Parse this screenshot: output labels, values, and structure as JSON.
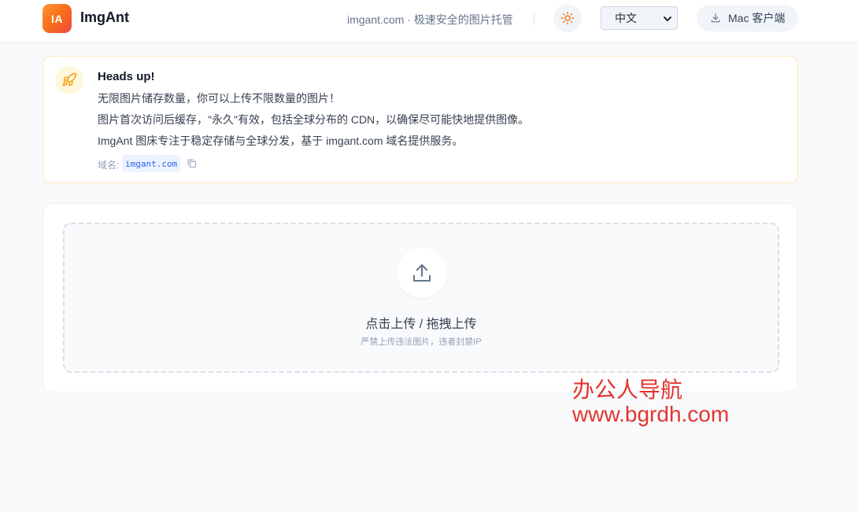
{
  "header": {
    "logo_text": "IA",
    "brand": "ImgAnt",
    "tagline": "imgant.com · 极速安全的图片托管",
    "theme_icon": "sun-icon",
    "language": "中文",
    "mac_button": "Mac 客户端",
    "mac_icon": "download-icon"
  },
  "notice": {
    "icon": "rocket-icon",
    "title": "Heads up!",
    "lines": [
      "无限图片储存数量，你可以上传不限数量的图片！",
      "图片首次访问后缓存，\"永久\"有效，包括全球分布的 CDN，以确保尽可能快地提供图像。",
      "ImgAnt 图床专注于稳定存储与全球分发，基于 imgant.com 域名提供服务。"
    ],
    "domain_label": "域名:",
    "domain": "imgant.com",
    "copy_icon": "copy-icon"
  },
  "upload": {
    "icon": "upload-icon",
    "title": "点击上传 / 拖拽上传",
    "subtitle": "严禁上传违法图片，违者封禁IP"
  },
  "watermark": {
    "line1": "办公人导航",
    "line2": "www.bgrdh.com"
  },
  "colors": {
    "accent_orange": "#f97316",
    "link_blue": "#2563eb",
    "watermark_red": "#e3342f"
  }
}
